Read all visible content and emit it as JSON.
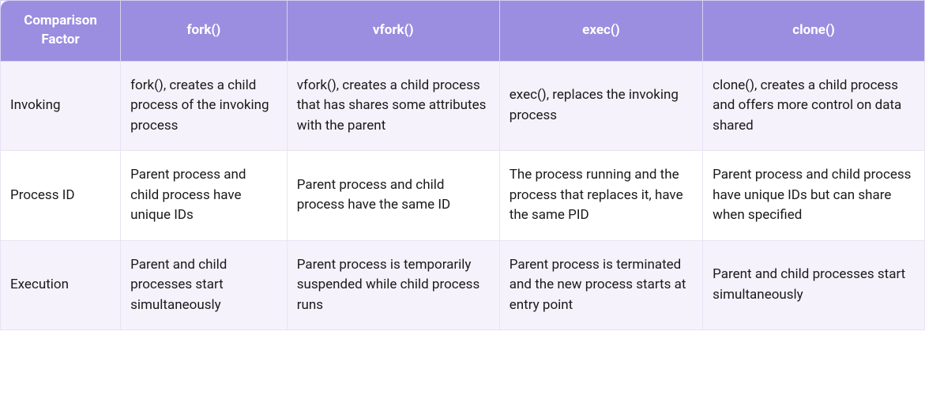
{
  "table": {
    "headers": [
      "Comparison Factor",
      "fork()",
      "vfork()",
      "exec()",
      "clone()"
    ],
    "rows": [
      {
        "factor": "Invoking",
        "fork": "fork(), creates a child process of the invoking process",
        "vfork": "vfork(), creates a child process that has shares some attributes with the parent",
        "exec": "exec(), replaces the invoking process",
        "clone": "clone(), creates a child process and offers more control on data shared"
      },
      {
        "factor": "Process ID",
        "fork": "Parent process and child process have unique IDs",
        "vfork": "Parent process and child process have the same ID",
        "exec": "The process running and the process that replaces it, have the same PID",
        "clone": "Parent process and child process have unique IDs but can share when specified"
      },
      {
        "factor": "Execution",
        "fork": "Parent and child processes start simultaneously",
        "vfork": "Parent process is temporarily suspended while child process runs",
        "exec": "Parent process is terminated and the new process starts at entry point",
        "clone": "Parent and child processes start simultaneously"
      }
    ]
  }
}
